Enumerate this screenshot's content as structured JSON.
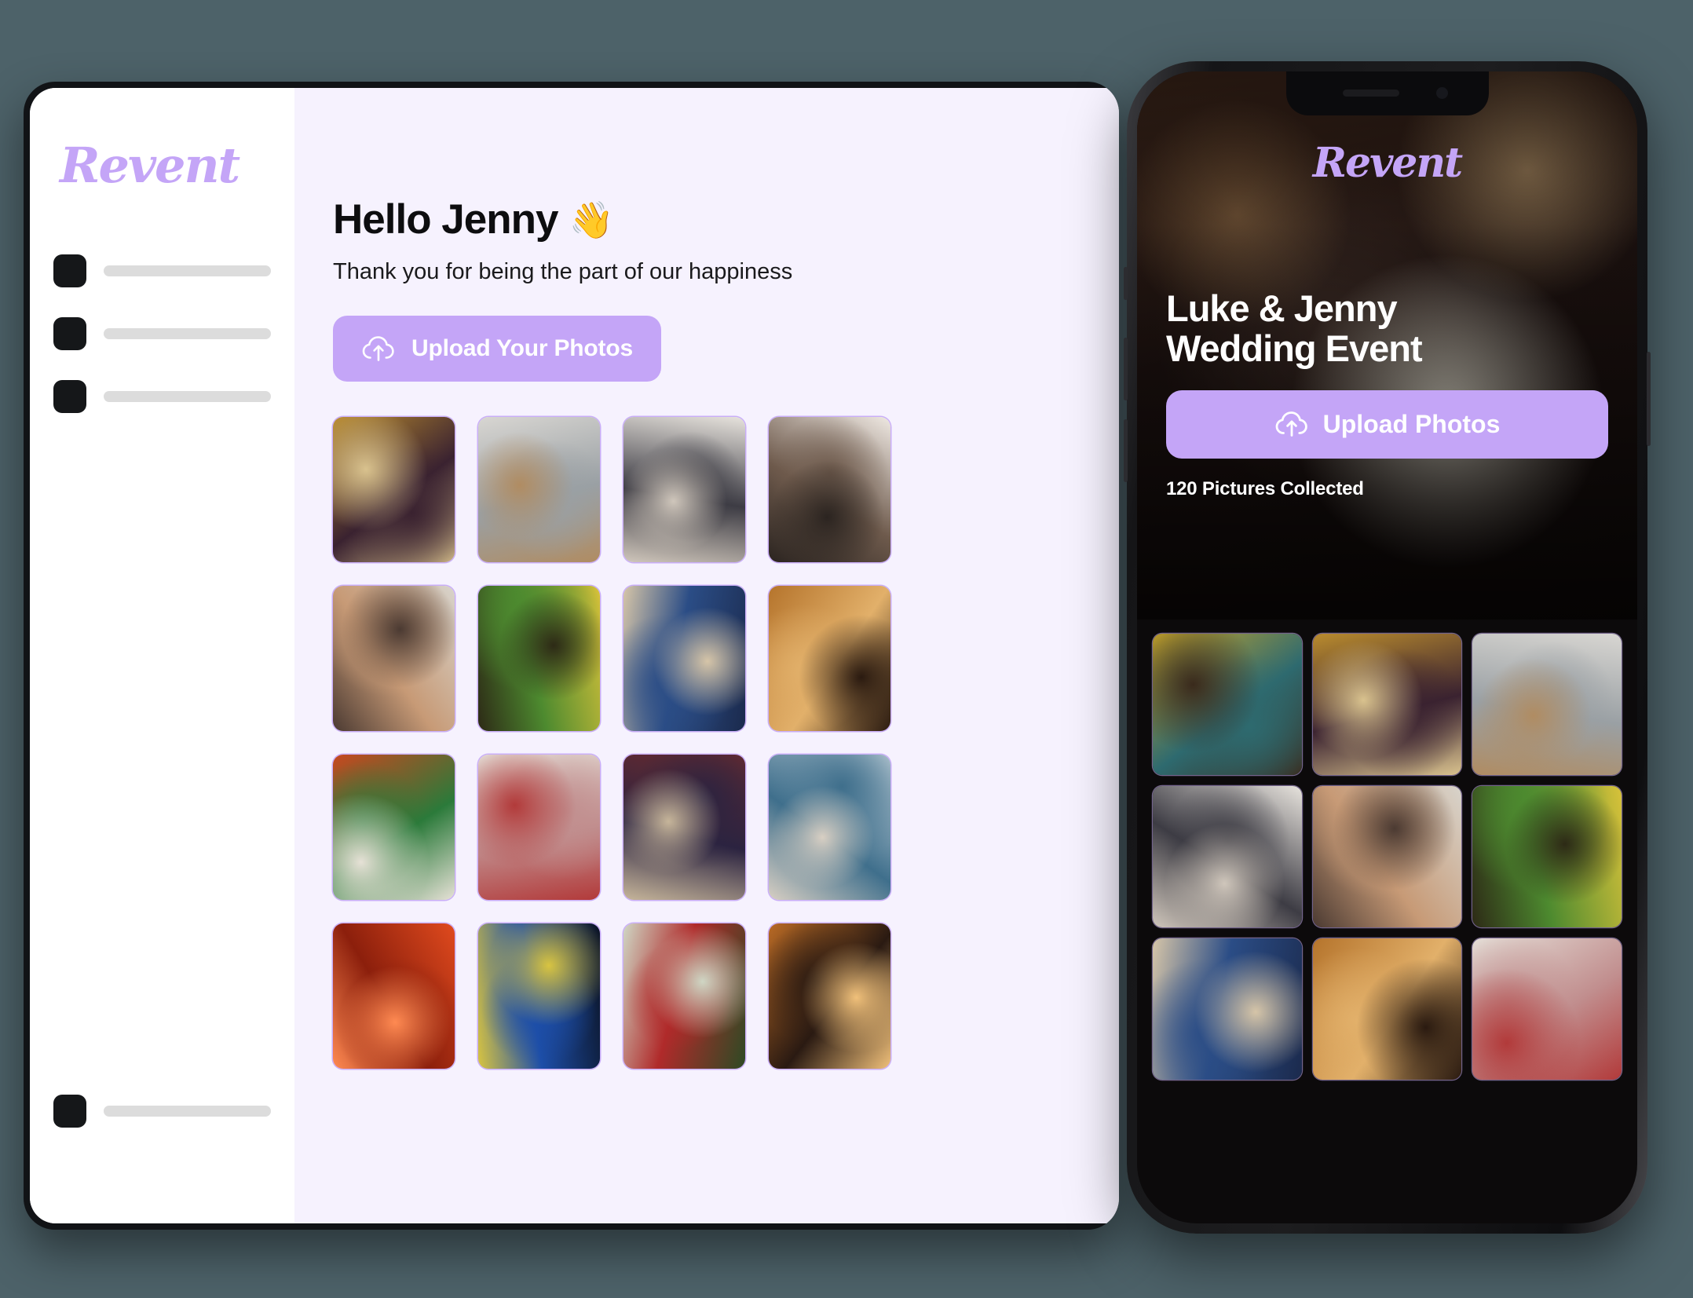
{
  "theme": {
    "page_background": "#4d6269",
    "accent_purple": "#c4a5f7",
    "tablet_surface": "#f6f2fe",
    "sidebar_surface": "#ffffff",
    "phone_screen": "#0c0a0b",
    "text_dark": "#0d0d0f"
  },
  "tablet": {
    "brand": "Revent",
    "sidebar": {
      "items": [
        {
          "label": ""
        },
        {
          "label": ""
        },
        {
          "label": ""
        }
      ],
      "bottom_item": {
        "label": ""
      }
    },
    "main": {
      "greeting": "Hello Jenny",
      "greeting_emoji": "👋",
      "subtitle": "Thank you for being the part of our happiness",
      "upload_button": {
        "label": "Upload Your Photos",
        "icon": "cloud-upload-icon"
      },
      "photos": [
        {
          "alt": "friends celebrating with gold streamers",
          "c1": "#b98b2e",
          "c2": "#3a2230",
          "c3": "#d9c28e"
        },
        {
          "alt": "elderly couple looking at phone by window blinds",
          "c1": "#d8d6d2",
          "c2": "#9aa0a4",
          "c3": "#b08c62"
        },
        {
          "alt": "bride and groom at floral arch",
          "c1": "#e7e3dd",
          "c2": "#3d3c44",
          "c3": "#cfc6bb"
        },
        {
          "alt": "hand holding phone filming wedding",
          "c1": "#efe9e3",
          "c2": "#6e5a4c",
          "c3": "#2b2420"
        },
        {
          "alt": "family in party hats with gold balloon",
          "c1": "#d8d4cc",
          "c2": "#c79a76",
          "c3": "#4b3a32"
        },
        {
          "alt": "concert crowd phone green and yellow lights",
          "c1": "#d8c23a",
          "c2": "#4d8a2f",
          "c3": "#2d2a16"
        },
        {
          "alt": "woman cheering at a live event",
          "c1": "#1b2a4d",
          "c2": "#2b4d86",
          "c3": "#d6c5a8"
        },
        {
          "alt": "candlelit dinner table filmed by phone",
          "c1": "#b5742c",
          "c2": "#e2b06a",
          "c3": "#2a1a10"
        },
        {
          "alt": "person in white hat filming parade",
          "c1": "#c7481f",
          "c2": "#2b7a3a",
          "c3": "#e6e1d6"
        },
        {
          "alt": "older woman in santa hat celebrating",
          "c1": "#e4ddd6",
          "c2": "#c18e8e",
          "c3": "#b23a3a"
        },
        {
          "alt": "audience seated in a hall",
          "c1": "#6a2b2f",
          "c2": "#2b2340",
          "c3": "#c6b59a"
        },
        {
          "alt": "child at a confetti party",
          "c1": "#cbd7de",
          "c2": "#3f6f8c",
          "c3": "#d8cfc3"
        },
        {
          "alt": "crowd with red flare smoke",
          "c1": "#e04a1e",
          "c2": "#8c1f0c",
          "c3": "#ff8a52"
        },
        {
          "alt": "night confetti over blue stage",
          "c1": "#0b1324",
          "c2": "#1d4ea8",
          "c3": "#d8c441"
        },
        {
          "alt": "red flowers and greenery",
          "c1": "#2d4a24",
          "c2": "#b02a2a",
          "c3": "#cfd6c4"
        },
        {
          "alt": "night street lights with phone",
          "c1": "#b96a25",
          "c2": "#2a1a12",
          "c3": "#f0c07a"
        }
      ]
    }
  },
  "phone": {
    "brand": "Revent",
    "hero_alt": "couple embracing at evening wedding reception",
    "event_title_line1": "Luke & Jenny",
    "event_title_line2": "Wedding Event",
    "upload_button": {
      "label": "Upload Photos",
      "icon": "cloud-upload-icon"
    },
    "collected_text": "120 Pictures Collected",
    "photos": [
      {
        "alt": "man photographing yellow blossom tree",
        "c1": "#c9a62a",
        "c2": "#2e6a6f",
        "c3": "#3a2a1c"
      },
      {
        "alt": "friends celebrating with gold streamers",
        "c1": "#b98b2e",
        "c2": "#3a2230",
        "c3": "#d9c28e"
      },
      {
        "alt": "elderly couple looking at phone",
        "c1": "#d8d6d2",
        "c2": "#9aa0a4",
        "c3": "#b08c62"
      },
      {
        "alt": "bride and groom filmed on phone",
        "c1": "#e7e3dd",
        "c2": "#3d3c44",
        "c3": "#cfc6bb"
      },
      {
        "alt": "family in party hats with gold balloon",
        "c1": "#d8d4cc",
        "c2": "#c79a76",
        "c3": "#4b3a32"
      },
      {
        "alt": "concert crowd phone green and yellow lights",
        "c1": "#d8c23a",
        "c2": "#4d8a2f",
        "c3": "#2d2a16"
      },
      {
        "alt": "woman cheering at a live event",
        "c1": "#1b2a4d",
        "c2": "#2b4d86",
        "c3": "#d6c5a8"
      },
      {
        "alt": "candlelit dinner table filmed by phone",
        "c1": "#b5742c",
        "c2": "#e2b06a",
        "c3": "#2a1a10"
      },
      {
        "alt": "older woman in santa hat celebrating",
        "c1": "#e4ddd6",
        "c2": "#c18e8e",
        "c3": "#b23a3a"
      }
    ]
  }
}
